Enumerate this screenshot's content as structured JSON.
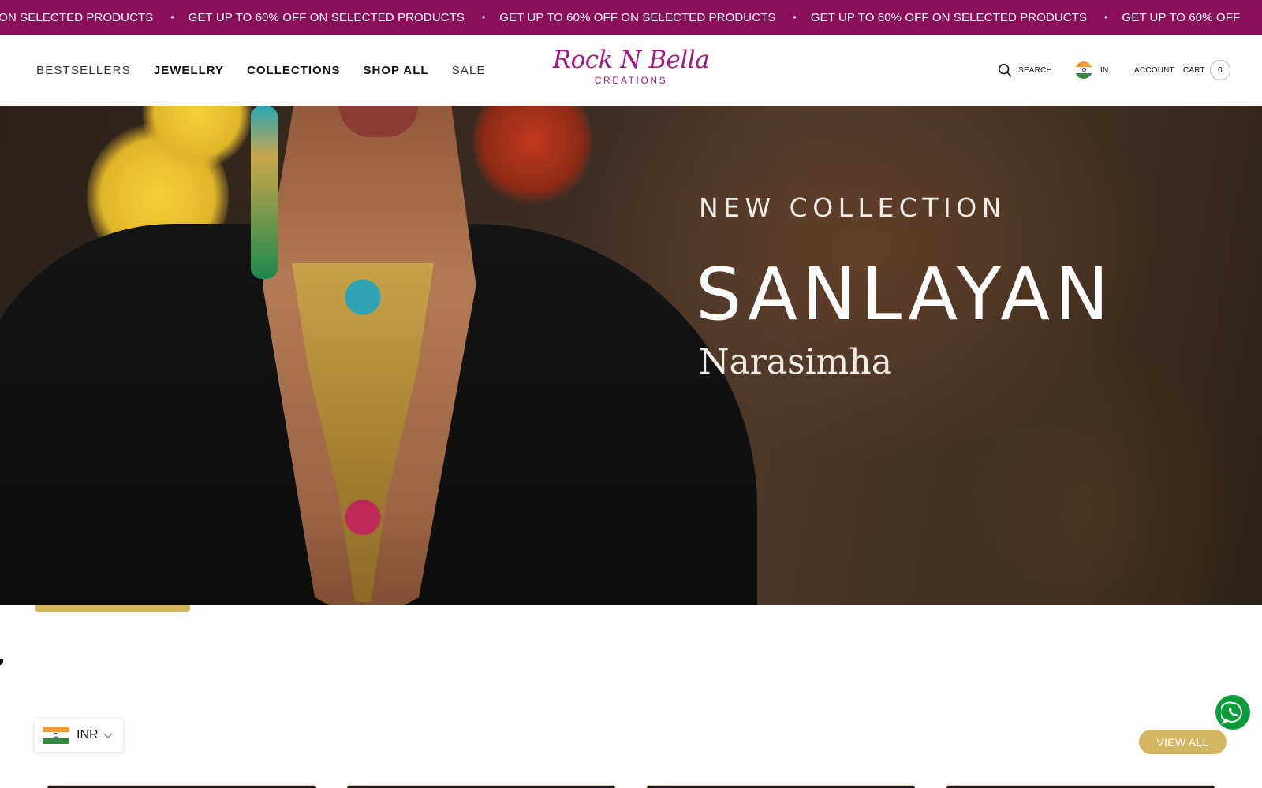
{
  "announcement": {
    "text": "GET UP TO 60% OFF ON SELECTED PRODUCTS",
    "partial_start": "TO 60% OFF ON SELECTED PRODUCTS",
    "partial_end": "GET UP TO 60% OFF",
    "bg_color": "#8a0e5a"
  },
  "nav": {
    "items": [
      "BESTSELLERS",
      "JEWELLRY",
      "COLLECTIONS",
      "SHOP ALL",
      "SALE"
    ]
  },
  "logo": {
    "script": "Rock N Bella",
    "sub": "CREATIONS",
    "color": "#a21781"
  },
  "header_actions": {
    "search_label": "SEARCH",
    "country_label": "IN",
    "account_label": "ACCOUNT",
    "cart_label": "CART",
    "cart_count": "0"
  },
  "hero": {
    "kicker": "NEW COLLECTION",
    "title": "SANLAYAN",
    "subtitle": "Narasimha"
  },
  "currency": {
    "code": "INR"
  },
  "view_all_label": "VIEW ALL",
  "colors": {
    "accent_gold": "#d4b562",
    "whatsapp_green": "#0a9b3a"
  }
}
